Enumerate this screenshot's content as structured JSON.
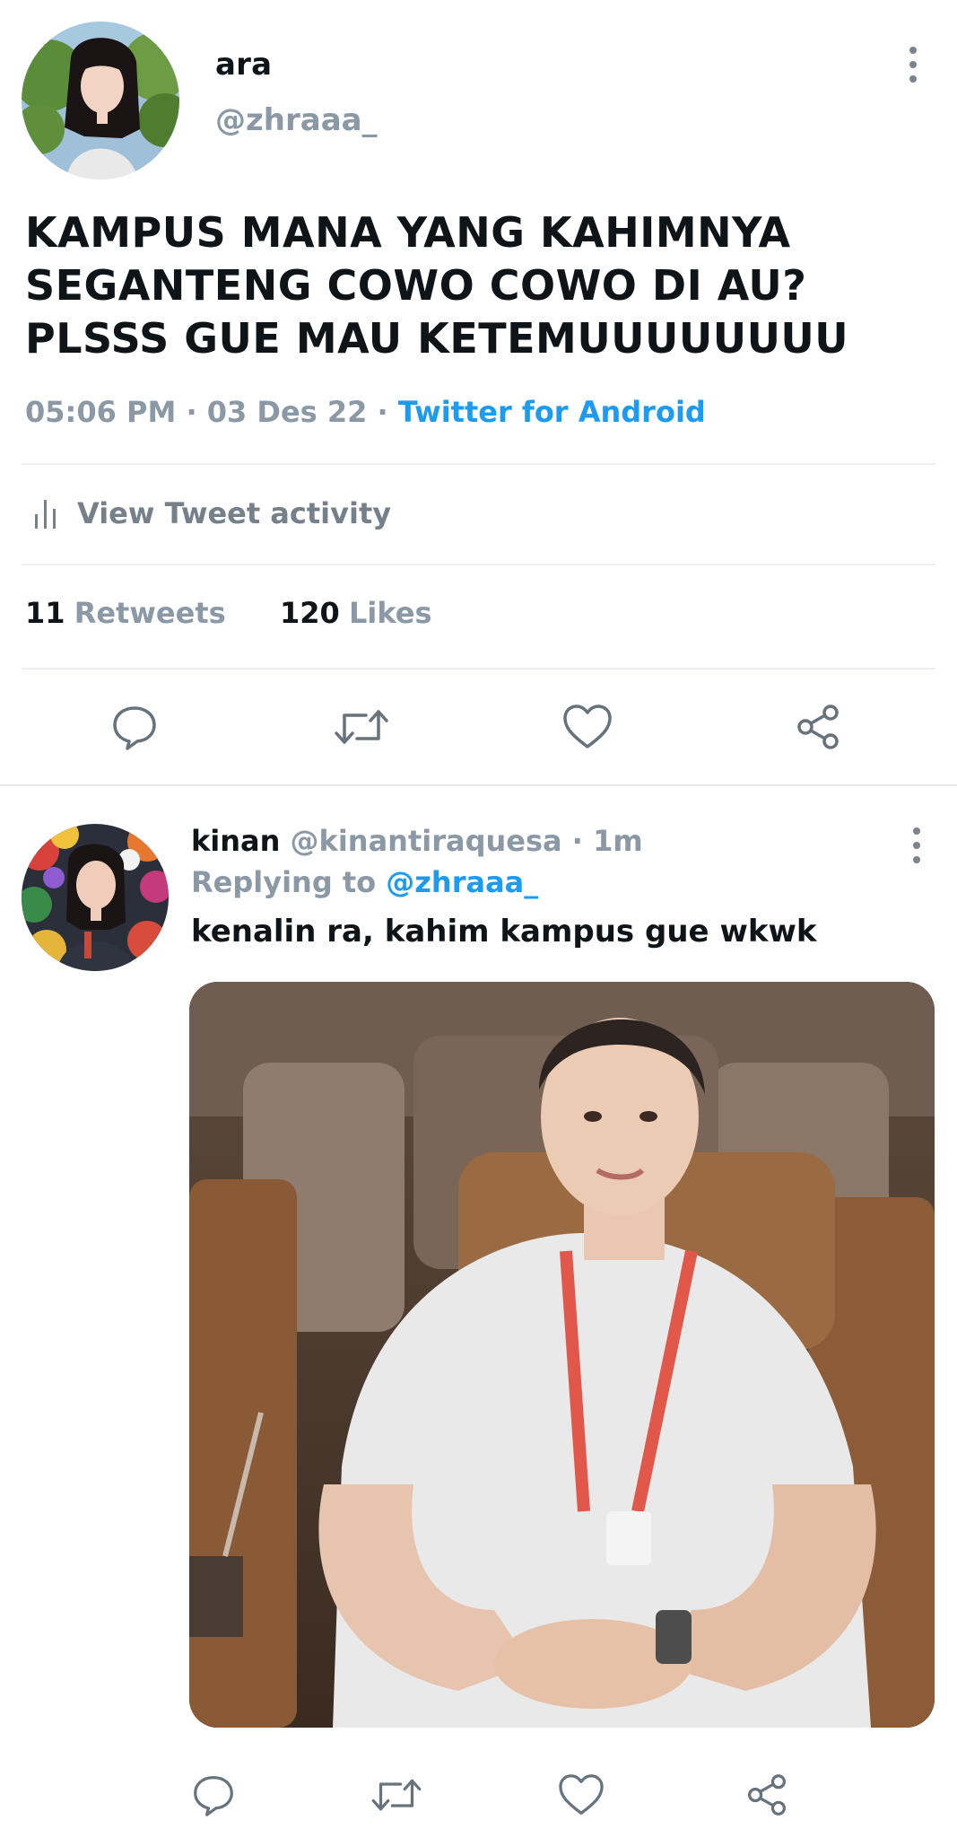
{
  "main_tweet": {
    "display_name": "ara",
    "handle": "@zhraaa_",
    "text_lines": [
      "KAMPUS MANA YANG KAHIMNYA",
      "SEGANTENG COWO COWO DI AU?",
      "PLSSS GUE MAU KETEMUUUUUUUU"
    ],
    "time": "05:06 PM",
    "date": "03 Des 22",
    "source": "Twitter for Android",
    "activity_label": "View Tweet activity",
    "retweets_count": "11",
    "retweets_label": "Retweets",
    "likes_count": "120",
    "likes_label": "Likes"
  },
  "reply": {
    "display_name": "kinan",
    "handle": "@kinantiraquesa",
    "time_ago": "1m",
    "replying_to_label": "Replying to",
    "replying_to_handle": "@zhraaa_",
    "text": "kenalin ra, kahim kampus gue wkwk"
  },
  "icons": {
    "more": "more-vertical-icon",
    "activity": "bar-chart-icon",
    "reply": "reply-bubble-icon",
    "retweet": "retweet-icon",
    "like": "heart-icon",
    "share": "share-icon"
  },
  "colors": {
    "text": "#0f1419",
    "muted": "#8b98a5",
    "link": "#1d9bf0",
    "divider": "#eceff1"
  }
}
